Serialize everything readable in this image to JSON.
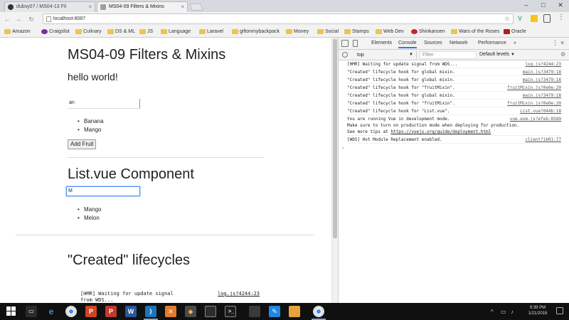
{
  "browser": {
    "tabs": [
      {
        "label": "dubsy07 / MS04-13 Fil"
      },
      {
        "label": "MS04-09 Filters & Mixins"
      }
    ],
    "url": "localhost:8087"
  },
  "bookmarks": [
    {
      "label": "Amazon"
    },
    {
      "label": "Craigslist"
    },
    {
      "label": "Culinary"
    },
    {
      "label": "DS & ML"
    },
    {
      "label": "JS"
    },
    {
      "label": "Language"
    },
    {
      "label": "Laravel"
    },
    {
      "label": "giftonmybackpack"
    },
    {
      "label": "Money"
    },
    {
      "label": "Social"
    },
    {
      "label": "Stamps"
    },
    {
      "label": "Web Dev"
    },
    {
      "label": "Shinkansen"
    },
    {
      "label": "Wars of the Roses"
    },
    {
      "label": "Oracle"
    }
  ],
  "page": {
    "title": "MS04-09 Filters & Mixins",
    "greeting": "hello world!",
    "fruit_input_value": "an",
    "fruit_list": [
      "Banana",
      "Mango"
    ],
    "add_button": "Add Fruit",
    "component_title": "List.vue Component",
    "component_input_value": "M",
    "component_list": [
      "Mango",
      "Melon"
    ],
    "lifecycle_title": "\"Created\" lifecycles",
    "log_text": "[HMR] Waiting for update signal from WDS...",
    "log_source": "log.js?4244:23"
  },
  "devtools": {
    "tabs": [
      "Elements",
      "Console",
      "Sources",
      "Network",
      "Performance",
      "»"
    ],
    "context": "top",
    "filter_placeholder": "Filter",
    "level": "Default levels",
    "lines": [
      {
        "text": "[HMR] Waiting for update signal from WDS...",
        "src": "log.js?4244:23"
      },
      {
        "text": "\"Created\" lifecycle hook for global mixin.",
        "src": "main.js?3479:18"
      },
      {
        "text": "\"Created\" lifecycle hook for global mixin.",
        "src": "main.js?3479:18"
      },
      {
        "text": "\"Created\" lifecycle hook for \"fruitMixin\".",
        "src": "fruitMixin.js?0e0e:20"
      },
      {
        "text": "\"Created\" lifecycle hook for global mixin.",
        "src": "main.js?3479:18"
      },
      {
        "text": "\"Created\" lifecycle hook for \"fruitMixin\".",
        "src": "fruitMixin.js?0e0e:20"
      },
      {
        "text": "\"Created\" lifecycle hook for \"List.vue\".",
        "src": "List.vue?044b:18"
      }
    ],
    "dev_mode_line1": "You are running Vue in development mode.",
    "dev_mode_src": "vue.esm.js?efeb:8589",
    "dev_mode_line2": "Make sure to turn on production mode when deploying for production.",
    "dev_mode_line3_prefix": "See more tips at ",
    "dev_mode_link": "https://vuejs.org/guide/deployment.html",
    "hmr_line": "[WDS] Hot Module Replacement enabled.",
    "hmr_src": "client?1b01:77"
  },
  "taskbar": {
    "time": "9:39 PM",
    "date": "1/21/2018"
  }
}
